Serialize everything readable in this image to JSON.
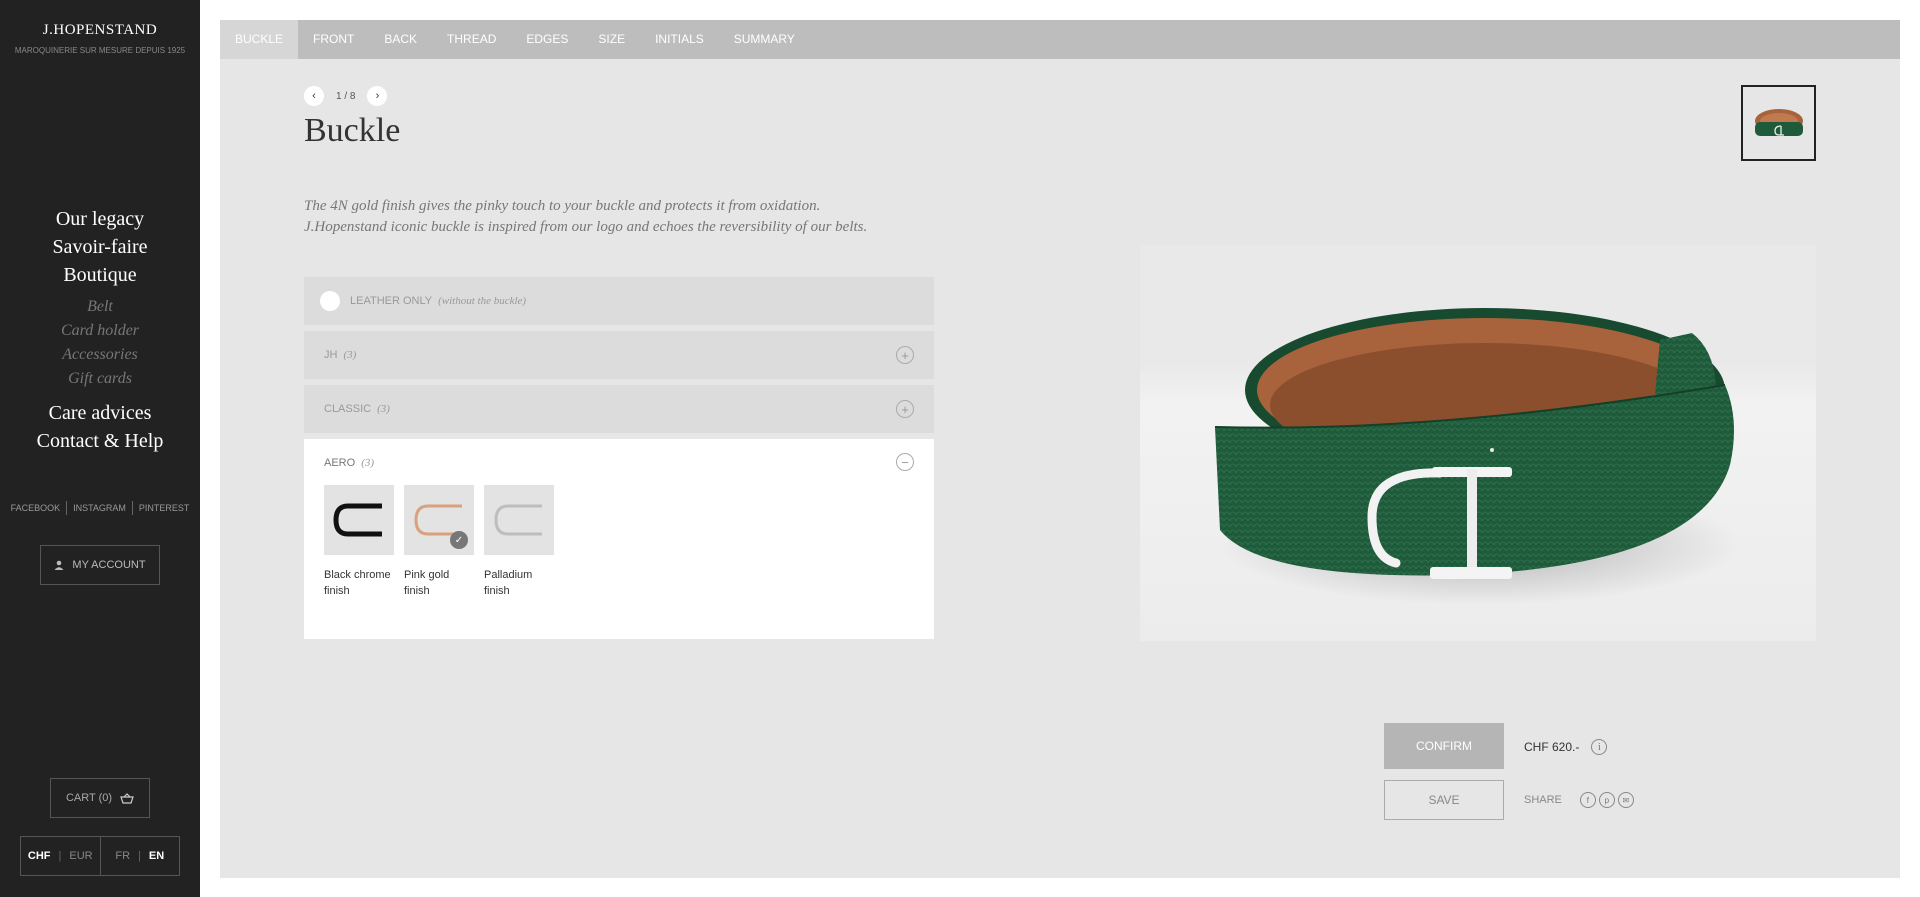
{
  "brand": {
    "name": "J.HOPENSTAND",
    "tagline": "MAROQUINERIE SUR MESURE DEPUIS 1925"
  },
  "nav": {
    "main": [
      "Our legacy",
      "Savoir-faire",
      "Boutique"
    ],
    "sub": [
      "Belt",
      "Card holder",
      "Accessories",
      "Gift cards"
    ],
    "main2": [
      "Care advices",
      "Contact & Help"
    ]
  },
  "social": [
    "FACEBOOK",
    "INSTAGRAM",
    "PINTEREST"
  ],
  "account": {
    "label": "MY ACCOUNT"
  },
  "cart": {
    "label": "CART (0)"
  },
  "currency": {
    "options": [
      "CHF",
      "EUR"
    ],
    "selected": "CHF"
  },
  "language": {
    "options": [
      "FR",
      "EN"
    ],
    "selected": "EN"
  },
  "tabs": [
    {
      "label": "BUCKLE",
      "active": true
    },
    {
      "label": "FRONT"
    },
    {
      "label": "BACK"
    },
    {
      "label": "THREAD"
    },
    {
      "label": "EDGES"
    },
    {
      "label": "SIZE"
    },
    {
      "label": "INITIALS"
    },
    {
      "label": "SUMMARY"
    }
  ],
  "pager": {
    "text": "1 / 8"
  },
  "step": {
    "title": "Buckle",
    "description_line1": "The 4N gold finish gives the pinky touch to your buckle and protects it from oxidation.",
    "description_line2": "J.Hopenstand iconic buckle is inspired from our logo and echoes the reversibility of our belts."
  },
  "options": {
    "leather_only": {
      "label": "LEATHER ONLY",
      "sub": "(without the buckle)"
    },
    "jh": {
      "label": "JH",
      "count": "(3)"
    },
    "classic": {
      "label": "CLASSIC",
      "count": "(3)"
    },
    "aero": {
      "label": "AERO",
      "count": "(3)",
      "swatches": [
        {
          "label_line1": "Black chrome",
          "label_line2": "finish",
          "color": "#111111"
        },
        {
          "label_line1": "Pink gold",
          "label_line2": "finish",
          "color": "#d9a17e",
          "selected": true
        },
        {
          "label_line1": "Palladium",
          "label_line2": "finish",
          "color": "#c8c8c8"
        }
      ]
    }
  },
  "actions": {
    "confirm": "CONFIRM",
    "price": "CHF 620.-",
    "save": "SAVE",
    "share": "SHARE"
  },
  "colors": {
    "sidebar": "#222222",
    "belt_leather": "#1f5a3a",
    "belt_lining": "#a8633c",
    "buckle": "#e8e8e8"
  }
}
